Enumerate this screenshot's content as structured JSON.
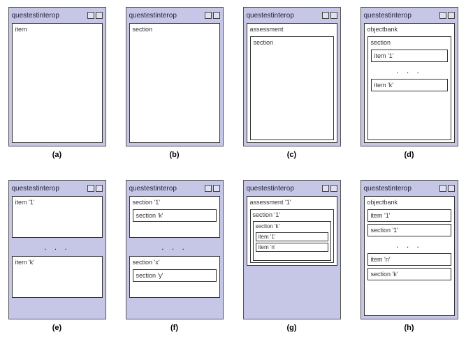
{
  "panels": {
    "a": {
      "title": "questestinterop",
      "caption": "(a)",
      "items": [
        "item"
      ]
    },
    "b": {
      "title": "questestinterop",
      "caption": "(b)",
      "items": [
        "section"
      ]
    },
    "c": {
      "title": "questestinterop",
      "caption": "(c)",
      "outer": "assessment",
      "inner": [
        "section"
      ]
    },
    "d": {
      "title": "questestinterop",
      "caption": "(d)",
      "outer": "objectbank",
      "section_label": "section",
      "items": [
        "item '1'",
        "item 'k'"
      ],
      "dots": ". . ."
    },
    "e": {
      "title": "questestinterop",
      "caption": "(e)",
      "items": [
        "item '1'",
        "item 'k'"
      ],
      "dots": ". . ."
    },
    "f": {
      "title": "questestinterop",
      "caption": "(f)",
      "sections": [
        {
          "label": "section '1'",
          "inner": "section 'k'"
        },
        {
          "label": "section 'x'",
          "inner": "section 'y'"
        }
      ],
      "dots": ". . ."
    },
    "g": {
      "title": "questestinterop",
      "caption": "(g)",
      "assessment": "assessment '1'",
      "section1": "section '1'",
      "sectionk": "section 'k'",
      "items": [
        "item '1'",
        "item 'n'"
      ]
    },
    "h": {
      "title": "questestinterop",
      "caption": "(h)",
      "outer": "objectbank",
      "items": [
        "item '1'",
        "section '1'",
        "item 'n'",
        "section 'k'"
      ],
      "dots": ". . ."
    }
  }
}
